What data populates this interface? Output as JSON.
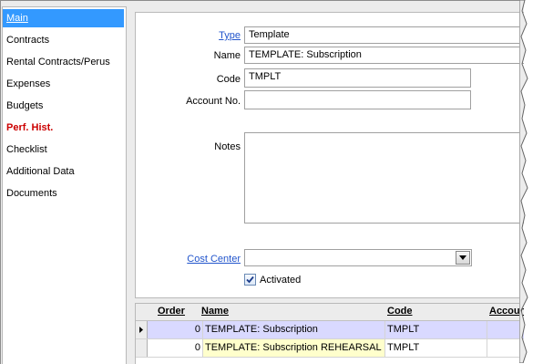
{
  "sidebar": {
    "items": [
      {
        "label": "Main"
      },
      {
        "label": "Contracts"
      },
      {
        "label": "Rental Contracts/Perus"
      },
      {
        "label": "Expenses"
      },
      {
        "label": "Budgets"
      },
      {
        "label": "Perf. Hist."
      },
      {
        "label": "Checklist"
      },
      {
        "label": "Additional Data"
      },
      {
        "label": "Documents"
      }
    ]
  },
  "form": {
    "type_label": "Type",
    "type_value": "Template",
    "name_label": "Name",
    "name_value": "TEMPLATE:  Subscription",
    "code_label": "Code",
    "code_value": "TMPLT",
    "account_label": "Account No.",
    "account_value": "",
    "notes_label": "Notes",
    "notes_value": "",
    "cost_center_label": "Cost Center",
    "cost_center_value": "",
    "activated_label": "Activated"
  },
  "grid": {
    "headers": {
      "order": "Order",
      "name": "Name",
      "code": "Code",
      "account": "Accoun"
    },
    "rows": [
      {
        "order": "0",
        "name": "TEMPLATE:  Subscription",
        "code": "TMPLT",
        "account": ""
      },
      {
        "order": "0",
        "name": "TEMPLATE:  Subscription REHEARSAL",
        "code": "TMPLT",
        "account": ""
      }
    ]
  }
}
